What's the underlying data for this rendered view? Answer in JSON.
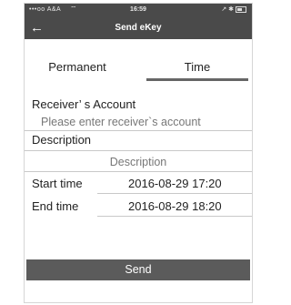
{
  "status_bar": {
    "carrier": "•••oo A&A",
    "wifi_icon": "wifi-icon",
    "time": "16:59",
    "right": "↗ ✱"
  },
  "nav": {
    "title": "Send eKey",
    "back_icon": "back-arrow-icon"
  },
  "tabs": [
    {
      "label": "Permanent",
      "active": false
    },
    {
      "label": "Time",
      "active": true
    }
  ],
  "form": {
    "receiver_label": "Receiver’ s Account",
    "receiver_placeholder": "Please enter receiver`s account",
    "description_label": "Description",
    "description_placeholder": "Description",
    "start_label": "Start time",
    "start_value": "2016-08-29 17:20",
    "end_label": "End time",
    "end_value": "2016-08-29 18:20"
  },
  "send_label": "Send",
  "colors": {
    "header_bg": "#4a4a4a",
    "button_bg": "#5b5b5b",
    "tab_indicator": "#666666"
  }
}
